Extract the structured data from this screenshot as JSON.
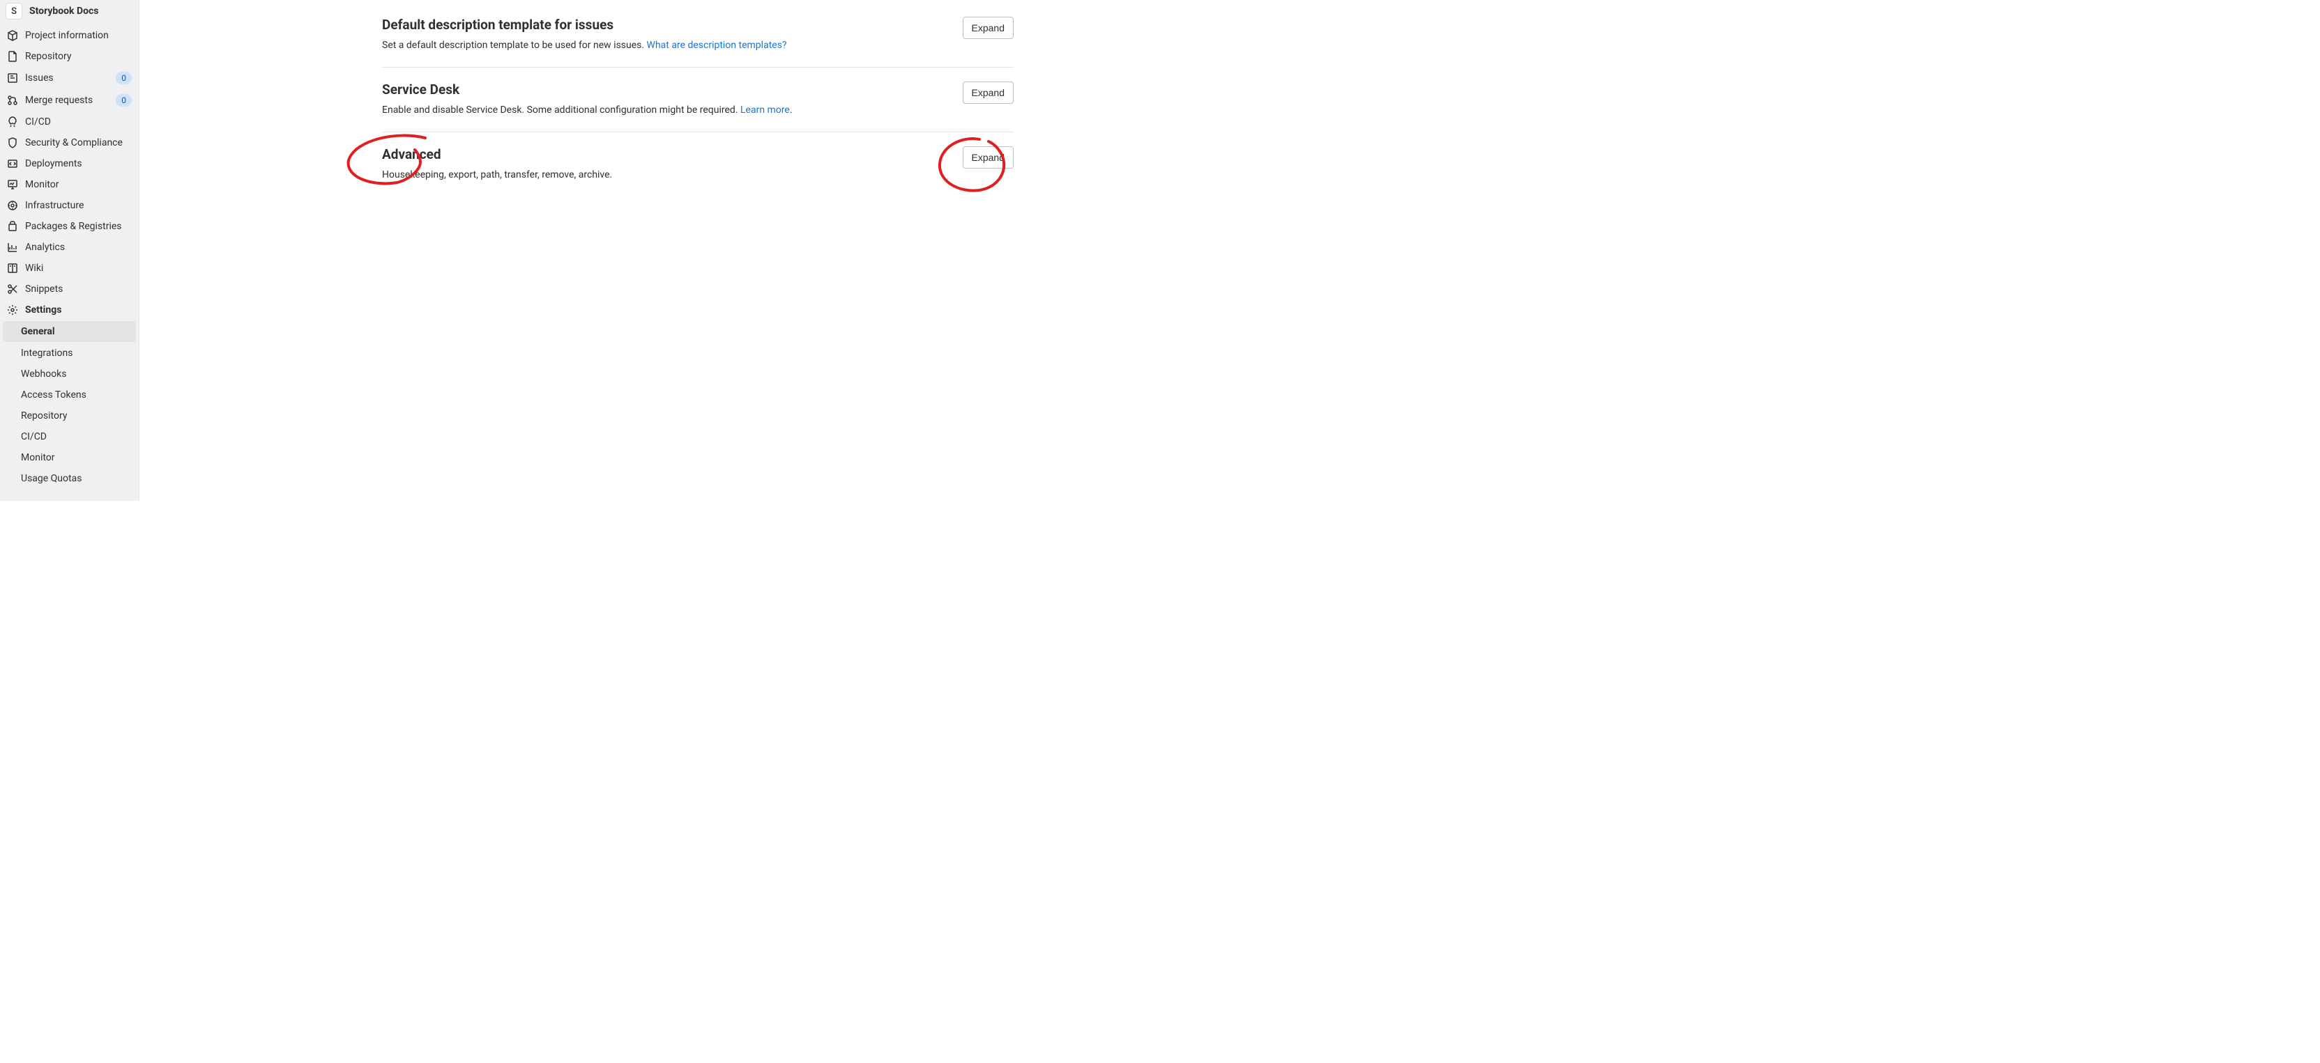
{
  "project": {
    "avatar_letter": "S",
    "name": "Storybook Docs"
  },
  "nav": {
    "project_info": "Project information",
    "repository": "Repository",
    "issues": "Issues",
    "issues_count": "0",
    "merge_requests": "Merge requests",
    "merge_requests_count": "0",
    "cicd": "CI/CD",
    "security": "Security & Compliance",
    "deployments": "Deployments",
    "monitor": "Monitor",
    "infrastructure": "Infrastructure",
    "packages": "Packages & Registries",
    "analytics": "Analytics",
    "wiki": "Wiki",
    "snippets": "Snippets",
    "settings": "Settings"
  },
  "settings_sub": {
    "general": "General",
    "integrations": "Integrations",
    "webhooks": "Webhooks",
    "access_tokens": "Access Tokens",
    "repository": "Repository",
    "cicd": "CI/CD",
    "monitor": "Monitor",
    "usage_quotas": "Usage Quotas"
  },
  "sections": {
    "desc_template": {
      "title": "Default description template for issues",
      "desc_pre": "Set a default description template to be used for new issues. ",
      "link": "What are description templates?",
      "expand": "Expand"
    },
    "service_desk": {
      "title": "Service Desk",
      "desc_pre": "Enable and disable Service Desk. Some additional configuration might be required. ",
      "link": "Learn more",
      "desc_post": ".",
      "expand": "Expand"
    },
    "advanced": {
      "title": "Advanced",
      "desc": "Housekeeping, export, path, transfer, remove, archive.",
      "expand": "Expand"
    }
  }
}
